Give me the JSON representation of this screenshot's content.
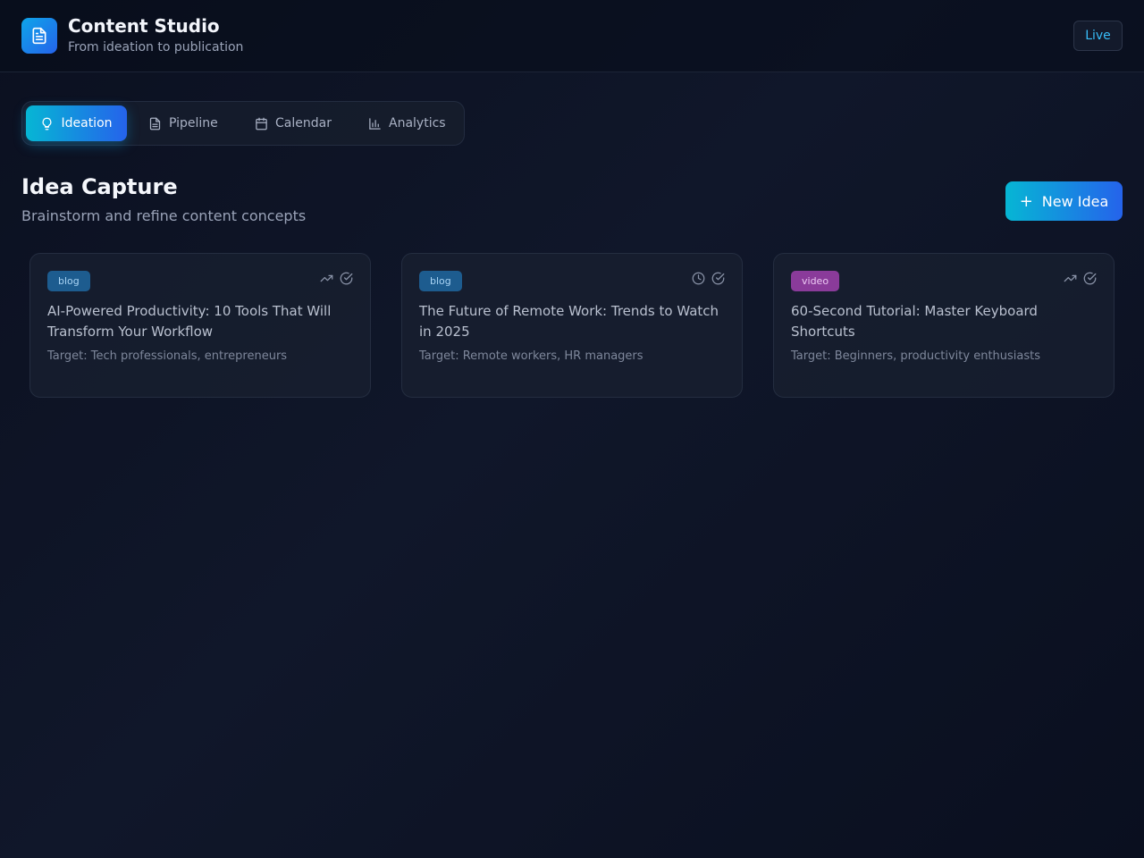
{
  "header": {
    "title": "Content Studio",
    "subtitle": "From ideation to publication",
    "status": "Live"
  },
  "tabs": [
    {
      "label": "Ideation",
      "icon": "lightbulb-icon",
      "active": true
    },
    {
      "label": "Pipeline",
      "icon": "document-icon",
      "active": false
    },
    {
      "label": "Calendar",
      "icon": "calendar-icon",
      "active": false
    },
    {
      "label": "Analytics",
      "icon": "bar-chart-icon",
      "active": false
    }
  ],
  "section": {
    "title": "Idea Capture",
    "subtitle": "Brainstorm and refine content concepts",
    "new_button": "New Idea"
  },
  "ideas": [
    {
      "type": "blog",
      "title": "AI-Powered Productivity: 10 Tools That Will Transform Your Workflow",
      "target": "Target: Tech professionals, entrepreneurs",
      "status_icon": "trending-up-icon"
    },
    {
      "type": "blog",
      "title": "The Future of Remote Work: Trends to Watch in 2025",
      "target": "Target: Remote workers, HR managers",
      "status_icon": "clock-icon"
    },
    {
      "type": "video",
      "title": "60-Second Tutorial: Master Keyboard Shortcuts",
      "target": "Target: Beginners, productivity enthusiasts",
      "status_icon": "trending-up-icon"
    }
  ],
  "colors": {
    "accent_start": "#06b6d4",
    "accent_end": "#2563eb",
    "blog_badge": "#1d5c8f",
    "video_badge": "#8a3b9a",
    "live": "#38bdf8"
  }
}
